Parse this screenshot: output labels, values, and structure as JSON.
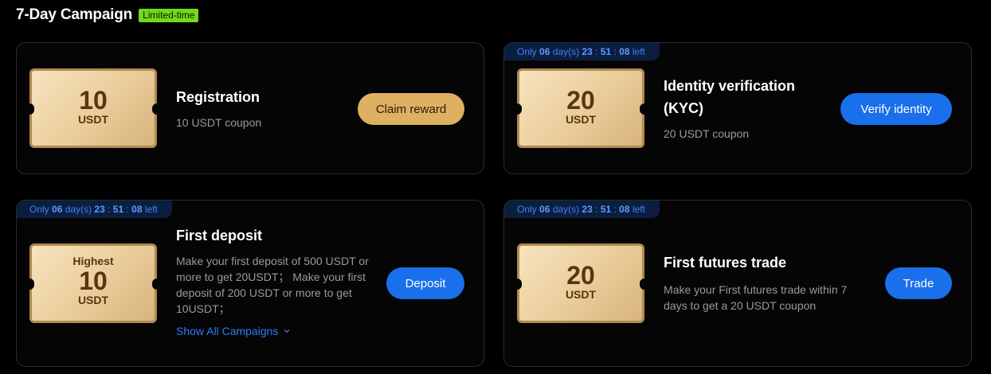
{
  "header": {
    "title": "7-Day Campaign",
    "badge": "Limited-time"
  },
  "timer": {
    "prefix": "Only",
    "days": "06",
    "days_label": "day(s)",
    "hh": "23",
    "mm": "51",
    "ss": "08",
    "suffix": "left"
  },
  "cards": [
    {
      "ticket_amount": "10",
      "ticket_unit": "USDT",
      "title": "Registration",
      "desc": "10 USDT coupon",
      "button": "Claim reward"
    },
    {
      "ticket_amount": "20",
      "ticket_unit": "USDT",
      "title": "Identity verification (KYC)",
      "desc": "20 USDT coupon",
      "button": "Verify identity"
    },
    {
      "ticket_top": "Highest",
      "ticket_amount": "10",
      "ticket_unit": "USDT",
      "title": "First deposit",
      "desc": "Make your first deposit of 500 USDT or more to get 20USDT； Make your first deposit of 200 USDT or more to get 10USDT；",
      "button": "Deposit",
      "link": "Show All Campaigns"
    },
    {
      "ticket_amount": "20",
      "ticket_unit": "USDT",
      "title": "First futures trade",
      "desc": "Make your First futures trade within 7 days to get a 20 USDT coupon",
      "button": "Trade"
    }
  ],
  "icons": {
    "link_chevron": "chevron-down-icon"
  },
  "colors": {
    "accent_blue": "#1a6fea",
    "gold_button": "#ddb062",
    "badge_green": "#72d91a"
  }
}
